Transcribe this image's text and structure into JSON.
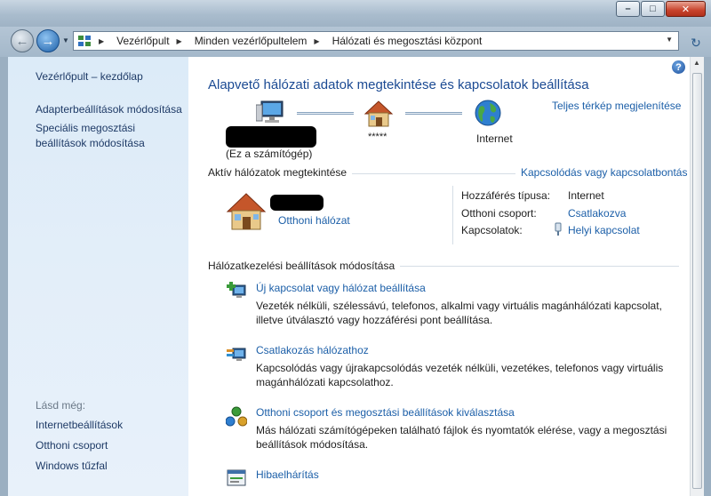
{
  "breadcrumb": {
    "items": [
      "Vezérlőpult",
      "Minden vezérlőpultelem",
      "Hálózati és megosztási központ"
    ]
  },
  "sidebar": {
    "home_link": "Vezérlőpult – kezdőlap",
    "links": [
      "Adapterbeállítások módosítása",
      "Speciális megosztási beállítások módosítása"
    ],
    "see_also_label": "Lásd még:",
    "see_also": [
      "Internetbeállítások",
      "Otthoni csoport",
      "Windows tűzfal"
    ]
  },
  "main": {
    "title": "Alapvető hálózati adatok megtekintése és kapcsolatok beállítása",
    "full_map_link": "Teljes térkép megjelenítése",
    "map": {
      "computer_label": "(Ez a számítógép)",
      "network_label": "*****",
      "internet_label": "Internet"
    },
    "active_section": {
      "header": "Aktív hálózatok megtekintése",
      "connect_link": "Kapcsolódás vagy kapcsolatbontás",
      "network_type_link": "Otthoni hálózat",
      "access_type_label": "Hozzáférés típusa:",
      "access_type_value": "Internet",
      "homegroup_label": "Otthoni csoport:",
      "homegroup_value": "Csatlakozva",
      "connections_label": "Kapcsolatok:",
      "connections_value": "Helyi kapcsolat"
    },
    "settings_section": {
      "header": "Hálózatkezelési beállítások módosítása",
      "tasks": [
        {
          "title": "Új kapcsolat vagy hálózat beállítása",
          "desc": "Vezeték nélküli, szélessávú, telefonos, alkalmi vagy virtuális magánhálózati kapcsolat, illetve útválasztó vagy hozzáférési pont beállítása."
        },
        {
          "title": "Csatlakozás hálózathoz",
          "desc": "Kapcsolódás vagy újrakapcsolódás vezeték nélküli, vezetékes, telefonos vagy virtuális magánhálózati kapcsolathoz."
        },
        {
          "title": "Otthoni csoport és megosztási beállítások kiválasztása",
          "desc": "Más hálózati számítógépeken található fájlok és nyomtatók elérése, vagy a megosztási beállítások módosítása."
        },
        {
          "title": "Hibaelhárítás",
          "desc": ""
        }
      ]
    }
  },
  "colors": {
    "link": "#1c5fa8",
    "title": "#1b4a93",
    "sidebar_bg": "#dcebf8",
    "sidebar_link": "#1e3a66"
  }
}
